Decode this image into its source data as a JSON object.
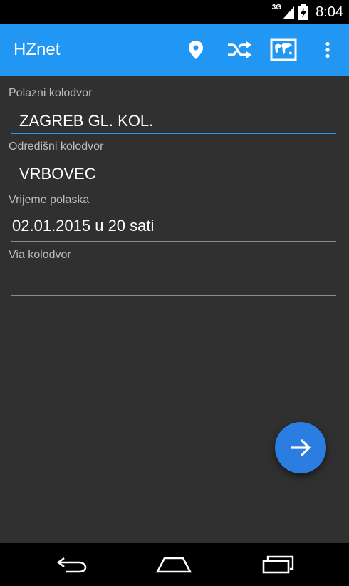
{
  "status_bar": {
    "network": "3G",
    "time": "8:04"
  },
  "app_bar": {
    "title": "HZnet",
    "actions": [
      "location-pin-icon",
      "shuffle-icon",
      "map-icon",
      "overflow-menu-icon"
    ]
  },
  "form": {
    "departure": {
      "label": "Polazni kolodvor",
      "value": "ZAGREB GL. KOL."
    },
    "destination": {
      "label": "Odredišni kolodvor",
      "value": "VRBOVEC"
    },
    "departure_time": {
      "label": "Vrijeme polaska",
      "value": "02.01.2015 u 20 sati"
    },
    "via": {
      "label": "Via kolodvor",
      "value": ""
    }
  },
  "fab_icon": "arrow-right-icon",
  "nav": [
    "back-icon",
    "home-icon",
    "recents-icon"
  ],
  "colors": {
    "accent": "#2196f3",
    "background": "#303030",
    "fab": "#2b7de2"
  }
}
